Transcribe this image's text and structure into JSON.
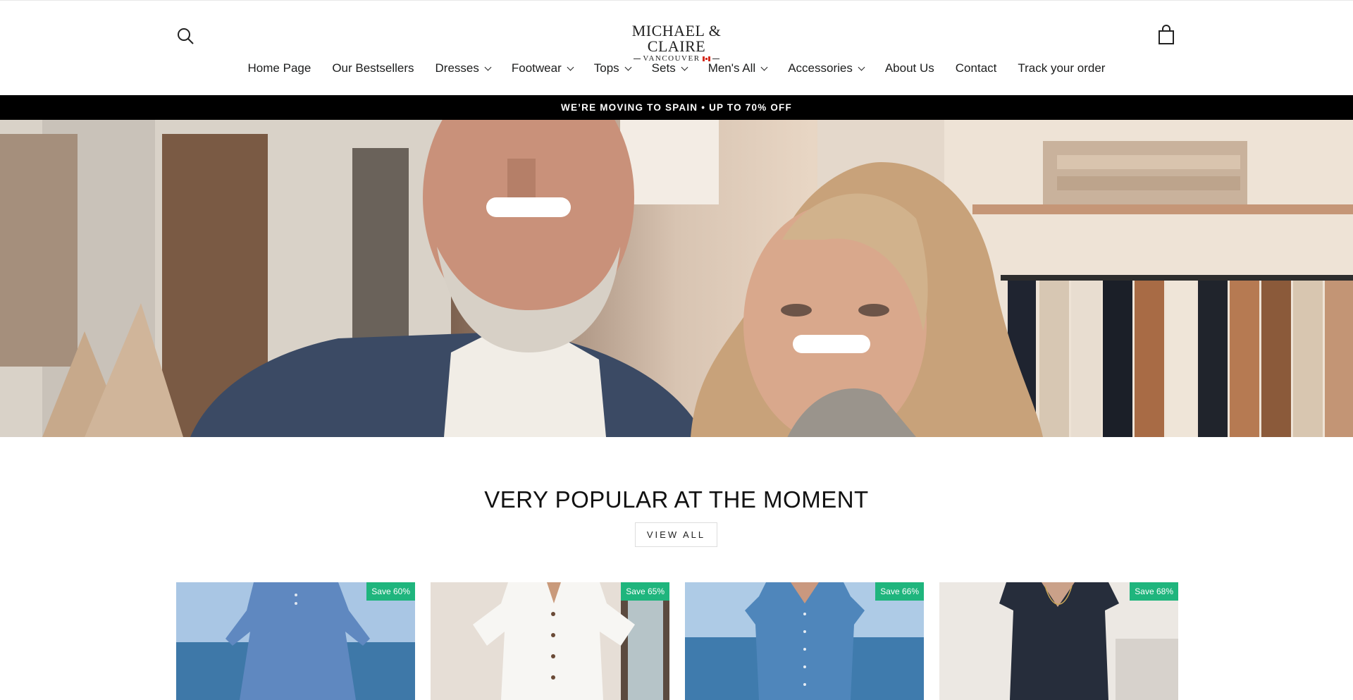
{
  "header": {
    "logo_main": "MICHAEL & CLAIRE",
    "logo_sub": "VANCOUVER"
  },
  "nav": [
    {
      "label": "Home Page",
      "dropdown": false
    },
    {
      "label": "Our Bestsellers",
      "dropdown": false
    },
    {
      "label": "Dresses",
      "dropdown": true
    },
    {
      "label": "Footwear",
      "dropdown": true
    },
    {
      "label": "Tops",
      "dropdown": true
    },
    {
      "label": "Sets",
      "dropdown": true
    },
    {
      "label": "Men's All",
      "dropdown": true
    },
    {
      "label": "Accessories",
      "dropdown": true
    },
    {
      "label": "About Us",
      "dropdown": false
    },
    {
      "label": "Contact",
      "dropdown": false
    },
    {
      "label": "Track your order",
      "dropdown": false
    }
  ],
  "announcement": "WE’RE MOVING TO SPAIN • UP TO 70% OFF",
  "section": {
    "title": "VERY POPULAR AT THE MOMENT",
    "view_all": "VIEW ALL"
  },
  "products": [
    {
      "badge": "Save 60%"
    },
    {
      "badge": "Save 65%"
    },
    {
      "badge": "Save 66%"
    },
    {
      "badge": "Save 68%"
    }
  ],
  "colors": {
    "announcement_bg": "#000000",
    "badge_bg": "#1fb57d"
  }
}
